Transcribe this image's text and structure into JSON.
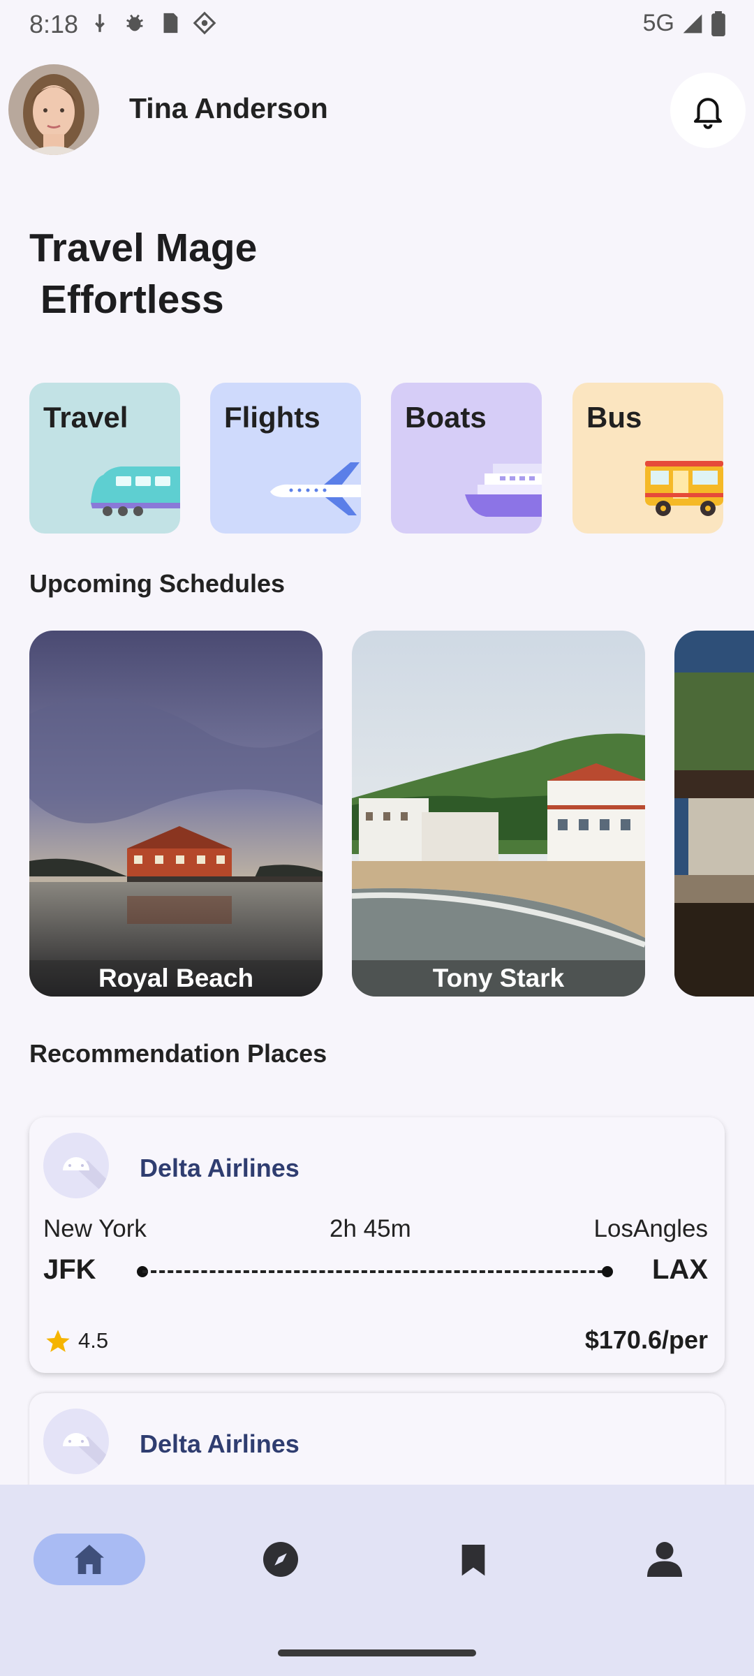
{
  "status_bar": {
    "time": "8:18",
    "network": "5G"
  },
  "header": {
    "user_name": "Tina Anderson"
  },
  "headline": "Travel Mage\n Effortless",
  "categories": [
    {
      "label": "Travel",
      "bg": "#c2e2e5"
    },
    {
      "label": "Flights",
      "bg": "#cfdafc"
    },
    {
      "label": "Boats",
      "bg": "#d6cdf7"
    },
    {
      "label": "Bus",
      "bg": "#fbe5c0"
    }
  ],
  "sections": {
    "upcoming": "Upcoming Schedules",
    "recommendations": "Recommendation Places"
  },
  "schedules": [
    {
      "name": "Royal Beach"
    },
    {
      "name": "Tony Stark"
    },
    {
      "name": ""
    }
  ],
  "recommendations": [
    {
      "airline": "Delta Airlines",
      "from_city": "New York",
      "to_city": "LosAngles",
      "duration": "2h 45m",
      "from_code": "JFK",
      "to_code": "LAX",
      "rating": "4.5",
      "price": "$170.6/per"
    },
    {
      "airline": "Delta Airlines"
    }
  ],
  "nav": [
    {
      "icon": "home-icon",
      "active": true
    },
    {
      "icon": "compass-icon",
      "active": false
    },
    {
      "icon": "bookmark-icon",
      "active": false
    },
    {
      "icon": "profile-icon",
      "active": false
    }
  ]
}
